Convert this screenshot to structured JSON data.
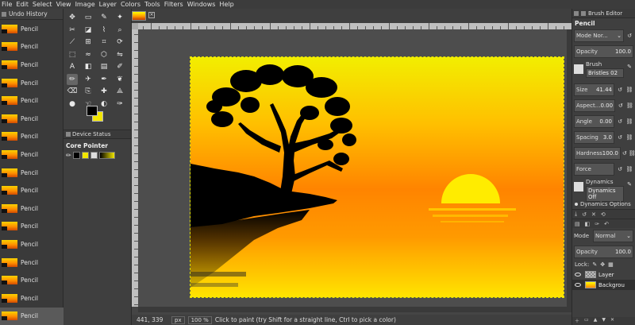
{
  "menubar": [
    "File",
    "Edit",
    "Select",
    "View",
    "Image",
    "Layer",
    "Colors",
    "Tools",
    "Filters",
    "Windows",
    "Help"
  ],
  "undo_history": {
    "tab_label": "Undo History",
    "items": [
      "Pencil",
      "Pencil",
      "Pencil",
      "Pencil",
      "Pencil",
      "Pencil",
      "Pencil",
      "Pencil",
      "Pencil",
      "Pencil",
      "Pencil",
      "Pencil",
      "Pencil",
      "Pencil",
      "Pencil",
      "Pencil",
      "Pencil"
    ],
    "selected_index": 16
  },
  "toolbox": {
    "tools": [
      {
        "icon": "move-icon",
        "glyph": "✥"
      },
      {
        "icon": "rect-select-icon",
        "glyph": "▭"
      },
      {
        "icon": "lasso-icon",
        "glyph": "✎"
      },
      {
        "icon": "fuzzy-select-icon",
        "glyph": "✦"
      },
      {
        "icon": "scissors-icon",
        "glyph": "✂"
      },
      {
        "icon": "foreground-select-icon",
        "glyph": "◪"
      },
      {
        "icon": "eyedropper-icon",
        "glyph": "⌇"
      },
      {
        "icon": "zoom-icon",
        "glyph": "⌕"
      },
      {
        "icon": "measure-icon",
        "glyph": "⟋"
      },
      {
        "icon": "align-icon",
        "glyph": "⊞"
      },
      {
        "icon": "crop-icon",
        "glyph": "⌗"
      },
      {
        "icon": "rotate-icon",
        "glyph": "⟳"
      },
      {
        "icon": "unified-transform-icon",
        "glyph": "⬚"
      },
      {
        "icon": "warp-icon",
        "glyph": "≈"
      },
      {
        "icon": "cage-icon",
        "glyph": "⬡"
      },
      {
        "icon": "flip-icon",
        "glyph": "⇋"
      },
      {
        "icon": "text-icon",
        "glyph": "A"
      },
      {
        "icon": "bucket-fill-icon",
        "glyph": "◧"
      },
      {
        "icon": "gradient-icon",
        "glyph": "▤"
      },
      {
        "icon": "paintbrush-icon",
        "glyph": "✐"
      },
      {
        "icon": "pencil-icon",
        "glyph": "✏"
      },
      {
        "icon": "airbrush-icon",
        "glyph": "✈"
      },
      {
        "icon": "ink-icon",
        "glyph": "✒"
      },
      {
        "icon": "mypaint-brush-icon",
        "glyph": "❦"
      },
      {
        "icon": "eraser-icon",
        "glyph": "⌫"
      },
      {
        "icon": "clone-icon",
        "glyph": "⎘"
      },
      {
        "icon": "heal-icon",
        "glyph": "✚"
      },
      {
        "icon": "perspective-clone-icon",
        "glyph": "⟁"
      },
      {
        "icon": "blur-icon",
        "glyph": "●"
      },
      {
        "icon": "smudge-icon",
        "glyph": "☜"
      },
      {
        "icon": "dodge-burn-icon",
        "glyph": "◐"
      },
      {
        "icon": "paths-icon",
        "glyph": "✑"
      }
    ],
    "active_index": 20,
    "device_status_label": "Device Status",
    "core_pointer_label": "Core Pointer"
  },
  "statusbar": {
    "coords": "441, 339",
    "unit": "px",
    "zoom": "100 %",
    "message": "Click to paint (try Shift for a straight line, Ctrl to pick a color)"
  },
  "right_dock": {
    "tab_label": "Brush Editor",
    "tool_title": "Pencil",
    "mode": "Mode Nor...",
    "opacity_label": "Opacity",
    "opacity_value": "100.0",
    "brush_label": "Brush",
    "brush_name": "Bristles 02",
    "params": [
      {
        "label": "Size",
        "value": "41.44"
      },
      {
        "label": "Aspect...",
        "value": "0.00"
      },
      {
        "label": "Angle",
        "value": "0.00"
      },
      {
        "label": "Spacing",
        "value": "3.0"
      },
      {
        "label": "Hardness",
        "value": "100.0"
      },
      {
        "label": "Force",
        "value": ""
      }
    ],
    "dynamics_label": "Dynamics",
    "dynamics_value": "Dynamics Off",
    "dynamics_options": "Dynamics Options",
    "layers": {
      "mode_label": "Mode",
      "mode_value": "Normal",
      "opacity_label": "Opacity",
      "opacity_value": "100.0",
      "lock_label": "Lock:",
      "items": [
        {
          "name": "Layer",
          "selected": false
        },
        {
          "name": "Backgrou",
          "selected": true
        }
      ]
    }
  },
  "colors": {
    "foreground": "#000000",
    "background": "#f2e600",
    "sky_top": "#f5ef00",
    "sky_mid": "#ffb400",
    "sky_low": "#ff7a00",
    "sun": "#ffee00"
  }
}
